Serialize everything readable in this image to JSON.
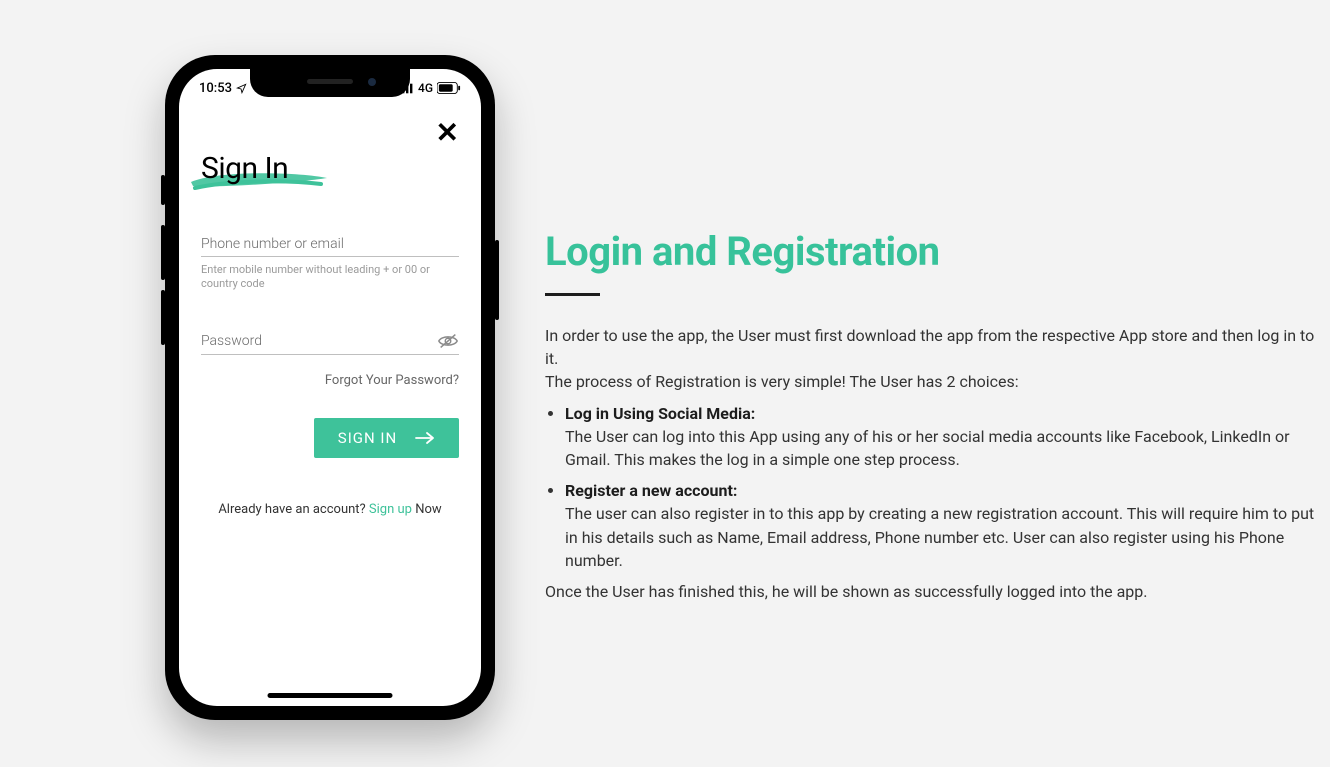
{
  "phone": {
    "status": {
      "time": "10:53",
      "network_label": "4G"
    },
    "close_label": "✕",
    "title": "Sign In",
    "phone_field": {
      "placeholder": "Phone number or email",
      "hint": "Enter mobile number without leading + or 00 or country code"
    },
    "password_field": {
      "placeholder": "Password"
    },
    "forgot_label": "Forgot Your Password?",
    "signin_button": "SIGN IN",
    "bottom": {
      "prefix": "Already have an account? ",
      "link": "Sign up",
      "suffix": " Now"
    }
  },
  "doc": {
    "title": "Login and Registration",
    "intro1": "In order to use the app, the User must first download the app from the respective App store and then log in to it.",
    "intro2": "The process of Registration is very simple! The User has 2 choices:",
    "bullets": [
      {
        "heading": "Log in Using Social Media:",
        "body": "The User can log into this App using any of his or her social media accounts like Facebook, LinkedIn or Gmail. This makes the log in a simple one step process."
      },
      {
        "heading": "Register a new account:",
        "body": "The user can also register in to this app by creating a new registration account. This will require him to put in his details such as Name, Email address, Phone number etc. User can also register using his Phone number."
      }
    ],
    "outro": "Once the User has finished this, he will be shown as successfully logged into the app."
  }
}
